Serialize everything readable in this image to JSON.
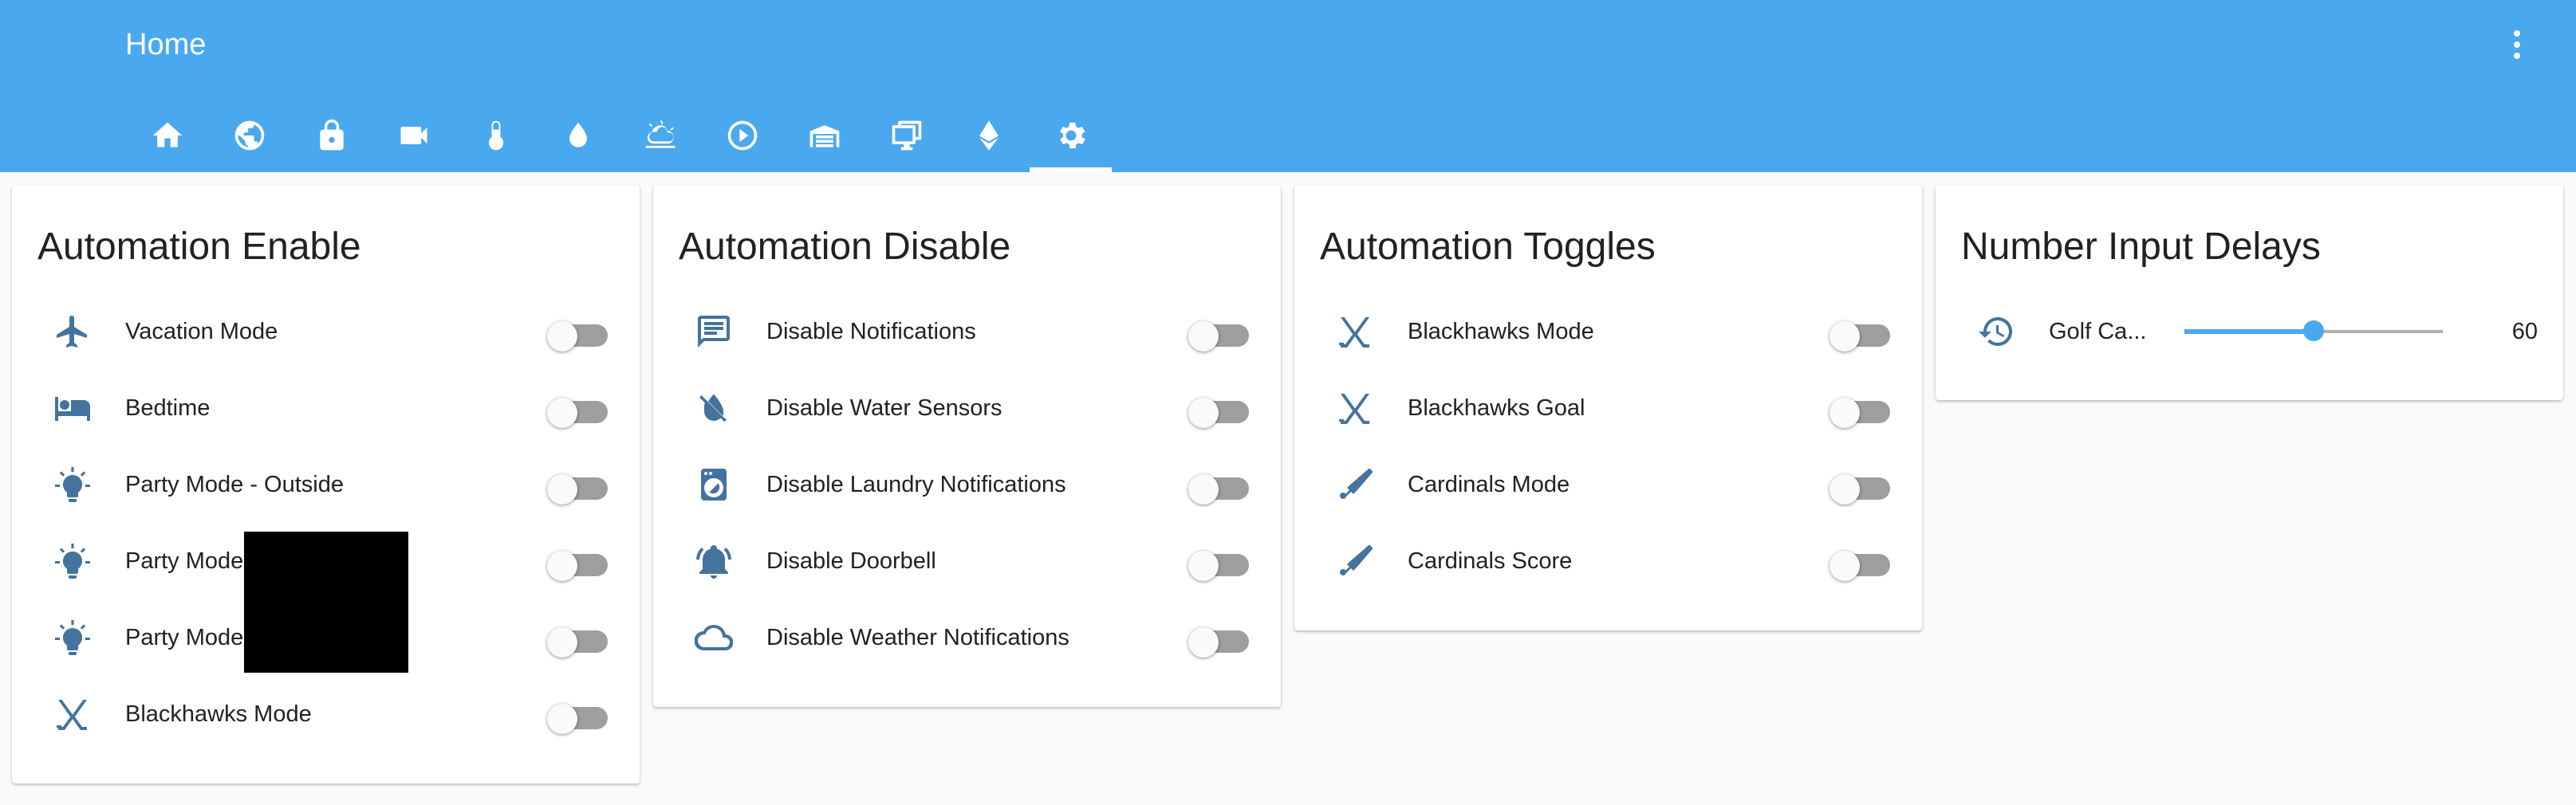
{
  "header": {
    "title": "Home",
    "menu_icon": "dots-vertical-icon",
    "tabs": [
      {
        "icon": "home-icon"
      },
      {
        "icon": "earth-icon"
      },
      {
        "icon": "lock-icon"
      },
      {
        "icon": "video-camera-icon"
      },
      {
        "icon": "thermometer-icon"
      },
      {
        "icon": "water-drop-icon"
      },
      {
        "icon": "weather-partly-cloudy-icon"
      },
      {
        "icon": "play-circle-icon"
      },
      {
        "icon": "garage-icon"
      },
      {
        "icon": "monitor-icon"
      },
      {
        "icon": "ethereum-icon"
      },
      {
        "icon": "gear-icon",
        "active": true
      }
    ]
  },
  "cards": [
    {
      "title": "Automation Enable",
      "rows": [
        {
          "icon": "airplane-icon",
          "label": "Vacation Mode",
          "on": false
        },
        {
          "icon": "bed-icon",
          "label": "Bedtime",
          "on": false
        },
        {
          "icon": "lightbulb-icon",
          "label": "Party Mode - Outside",
          "on": false
        },
        {
          "icon": "lightbulb-icon",
          "label": "Party Mode",
          "on": false
        },
        {
          "icon": "lightbulb-icon",
          "label": "Party Mode",
          "on": false
        },
        {
          "icon": "hockey-sticks-icon",
          "label": "Blackhawks Mode",
          "on": false
        }
      ]
    },
    {
      "title": "Automation Disable",
      "rows": [
        {
          "icon": "message-text-icon",
          "label": "Disable Notifications",
          "on": false
        },
        {
          "icon": "water-off-icon",
          "label": "Disable Water Sensors",
          "on": false
        },
        {
          "icon": "washing-machine-icon",
          "label": "Disable Laundry Notifications",
          "on": false
        },
        {
          "icon": "bell-ring-icon",
          "label": "Disable Doorbell",
          "on": false
        },
        {
          "icon": "cloud-outline-icon",
          "label": "Disable Weather Notifications",
          "on": false
        }
      ]
    },
    {
      "title": "Automation Toggles",
      "rows": [
        {
          "icon": "hockey-sticks-icon",
          "label": "Blackhawks Mode",
          "on": false
        },
        {
          "icon": "hockey-sticks-icon",
          "label": "Blackhawks Goal",
          "on": false
        },
        {
          "icon": "baseball-bat-icon",
          "label": "Cardinals Mode",
          "on": false
        },
        {
          "icon": "baseball-bat-icon",
          "label": "Cardinals Score",
          "on": false
        }
      ]
    },
    {
      "title": "Number Input Delays",
      "number_rows": [
        {
          "icon": "history-icon",
          "label": "Golf Ca...",
          "value": "60",
          "fraction": 0.5
        }
      ]
    }
  ],
  "colors": {
    "header": "#4aa8ee",
    "icon": "#44739e",
    "slider": "#4aa8ee"
  }
}
